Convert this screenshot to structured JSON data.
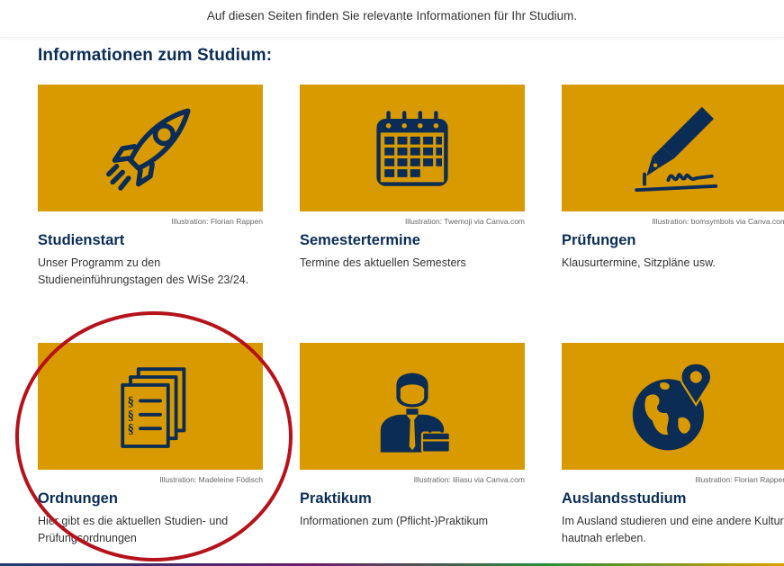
{
  "intro_text": "Auf diesen Seiten finden Sie relevante Informationen für Ihr Studium.",
  "section_title": "Informationen zum Studium:",
  "colors": {
    "tile_bg": "#d99a00",
    "icon_navy": "#0b2d55",
    "title_navy": "#0b2d55",
    "annotation_red": "#b5121b"
  },
  "cards": [
    {
      "icon": "rocket-icon",
      "credit": "Illustration: Florian Rappen",
      "title": "Studienstart",
      "desc": "Unser Programm zu den Studieneinführungstagen des WiSe 23/24."
    },
    {
      "icon": "calendar-icon",
      "credit": "Illustration: Twemoji via Canva.com",
      "title": "Semestertermine",
      "desc": "Termine des aktuellen Semesters"
    },
    {
      "icon": "pen-signature-icon",
      "credit": "Illustration: bomsymbols via Canva.com",
      "title": "Prüfungen",
      "desc": "Klausurtermine, Sitzpläne usw."
    },
    {
      "icon": "documents-paragraph-icon",
      "credit": "Illustration: Madeleine Födisch",
      "title": "Ordnungen",
      "desc": "Hier gibt es die aktuellen Studien- und Prüfungsordnungen"
    },
    {
      "icon": "person-briefcase-icon",
      "credit": "Illustration: liliasu via Canva.com",
      "title": "Praktikum",
      "desc": "Informationen zum (Pflicht-)Praktikum"
    },
    {
      "icon": "globe-pin-icon",
      "credit": "Illustration: Florian Rappen",
      "title": "Auslandsstudium",
      "desc": "Im Ausland studieren und eine andere Kultur hautnah erleben."
    }
  ]
}
